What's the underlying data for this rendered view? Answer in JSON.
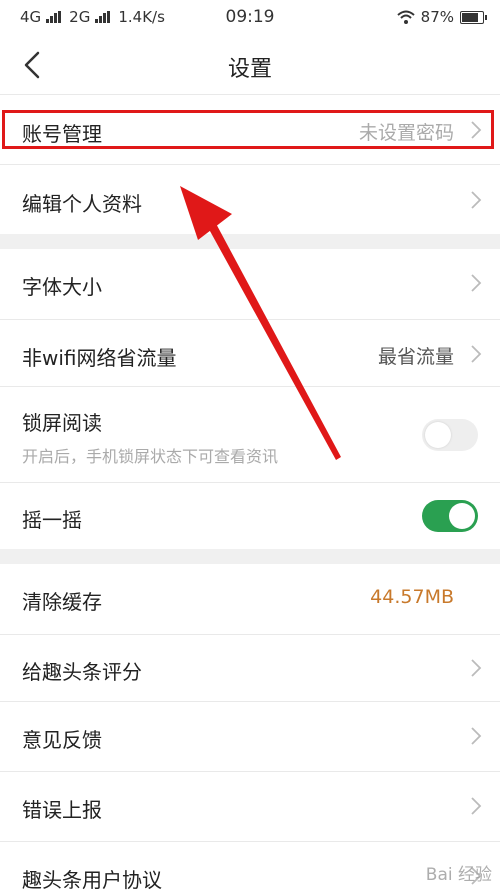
{
  "status_bar": {
    "network1": "4G",
    "network2": "2G",
    "speed": "1.4K/s",
    "time": "09:19",
    "battery": "87%",
    "battery_level": 0.87
  },
  "nav": {
    "title": "设置"
  },
  "rows": {
    "account": {
      "label": "账号管理",
      "value": "未设置密码"
    },
    "edit_profile": {
      "label": "编辑个人资料"
    },
    "font_size": {
      "label": "字体大小"
    },
    "non_wifi": {
      "label": "非wifi网络省流量",
      "value": "最省流量"
    },
    "lock_read": {
      "label": "锁屏阅读",
      "sub": "开启后，手机锁屏状态下可查看资讯",
      "enabled": false
    },
    "shake": {
      "label": "摇一摇",
      "enabled": true
    },
    "clear_cache": {
      "label": "清除缓存",
      "value": "44.57MB"
    },
    "rate": {
      "label": "给趣头条评分"
    },
    "feedback": {
      "label": "意见反馈"
    },
    "report": {
      "label": "错误上报"
    },
    "agreement": {
      "label": "趣头条用户协议"
    }
  },
  "watermark": {
    "text": "Bai 经验"
  },
  "colors": {
    "highlight": "#e01818",
    "toggle_on": "#2aa051",
    "toggle_off": "#eeeeee",
    "cache_value": "#c8792b",
    "section_gap": "#f0f0f0"
  },
  "icons": {
    "back": "chevron-left-icon",
    "row_arrow": "chevron-right-icon",
    "wifi": "wifi-icon",
    "battery": "battery-icon",
    "signal": "signal-icon"
  }
}
